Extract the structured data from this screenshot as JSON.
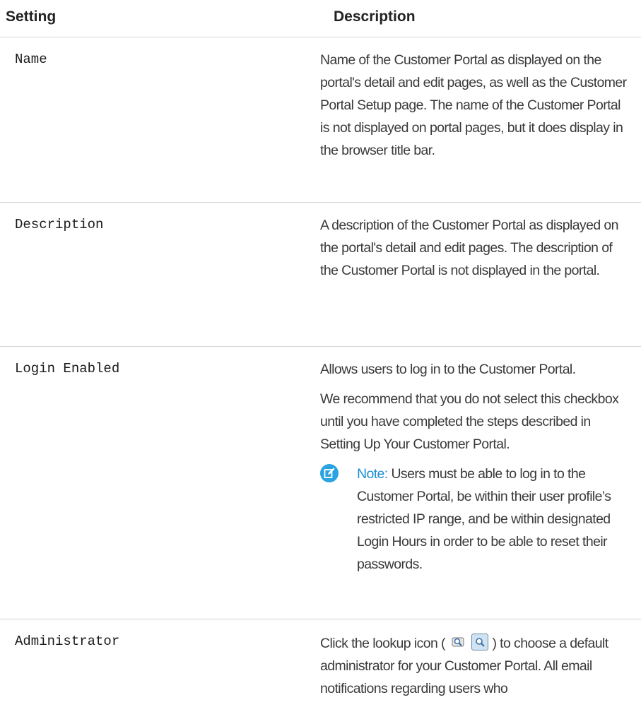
{
  "header": {
    "setting": "Setting",
    "description": "Description"
  },
  "rows": [
    {
      "setting": "Name",
      "description": "Name of the Customer Portal as displayed on the portal's detail and edit pages, as well as the Customer Portal Setup page. The name of the Customer Portal is not displayed on portal pages, but it does display in the browser title bar."
    },
    {
      "setting": "Description",
      "description": "A description of the Customer Portal as displayed on the portal's detail and edit pages. The description of the Customer Portal is not displayed in the portal."
    },
    {
      "setting": "Login Enabled",
      "description": "Allows users to log in to the Customer Portal.",
      "description2": "We recommend that you do not select this checkbox until you have completed the steps described in Setting Up Your Customer Portal.",
      "note_label": "Note:",
      "note_text": "Users must be able to log in to the Customer Portal, be within their user profile’s restricted IP range, and be within designated Login Hours in order to be able to reset their passwords."
    },
    {
      "setting": "Administrator",
      "description_before": "Click the lookup icon (",
      "description_after": ") to choose a default administrator for your Customer Portal. All email notifications regarding users who"
    }
  ],
  "icons": {
    "note": "note-edit-icon",
    "lookup": "lookup-icon"
  },
  "colors": {
    "note_accent": "#1a8fd1",
    "divider": "#d4d4d4"
  }
}
